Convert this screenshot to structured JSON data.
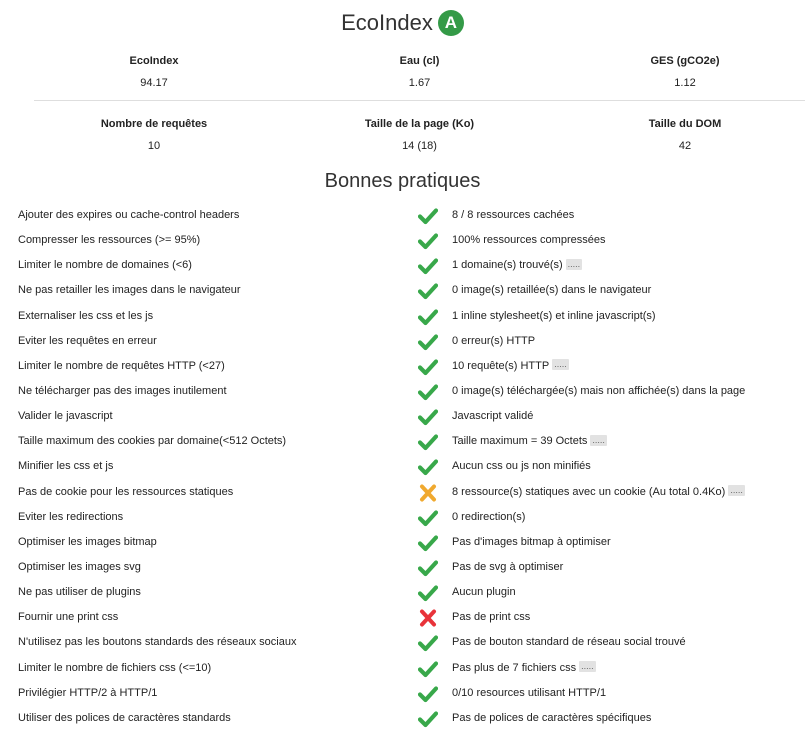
{
  "header": {
    "title": "EcoIndex",
    "grade": "A",
    "grade_color": "#349a47"
  },
  "metrics": {
    "row1": [
      {
        "label": "EcoIndex",
        "value": "94.17"
      },
      {
        "label": "Eau (cl)",
        "value": "1.67"
      },
      {
        "label": "GES (gCO2e)",
        "value": "1.12"
      }
    ],
    "row2": [
      {
        "label": "Nombre de requêtes",
        "value": "10"
      },
      {
        "label": "Taille de la page (Ko)",
        "value": "14 (18)"
      },
      {
        "label": "Taille du DOM",
        "value": "42"
      }
    ]
  },
  "practices_title": "Bonnes pratiques",
  "status_colors": {
    "ok": "#38a84a",
    "warning": "#f0a92f",
    "error": "#e8333a"
  },
  "practices": [
    {
      "name": "Ajouter des expires ou cache-control headers",
      "status": "ok",
      "detail": "8 / 8 ressources cachées",
      "more": ""
    },
    {
      "name": "Compresser les ressources (>= 95%)",
      "status": "ok",
      "detail": "100% ressources compressées",
      "more": ""
    },
    {
      "name": "Limiter le nombre de domaines (<6)",
      "status": "ok",
      "detail": "1 domaine(s) trouvé(s)",
      "more": "....."
    },
    {
      "name": "Ne pas retailler les images dans le navigateur",
      "status": "ok",
      "detail": "0 image(s) retaillée(s) dans le navigateur",
      "more": ""
    },
    {
      "name": "Externaliser les css et les js",
      "status": "ok",
      "detail": "1 inline stylesheet(s) et inline javascript(s)",
      "more": ""
    },
    {
      "name": "Eviter les requêtes en erreur",
      "status": "ok",
      "detail": "0 erreur(s) HTTP",
      "more": ""
    },
    {
      "name": "Limiter le nombre de requêtes HTTP (<27)",
      "status": "ok",
      "detail": "10 requête(s) HTTP",
      "more": "....."
    },
    {
      "name": "Ne télécharger pas des images inutilement",
      "status": "ok",
      "detail": "0 image(s) téléchargée(s) mais non affichée(s) dans la page",
      "more": ""
    },
    {
      "name": "Valider le javascript",
      "status": "ok",
      "detail": "Javascript validé",
      "more": ""
    },
    {
      "name": "Taille maximum des cookies par domaine(<512 Octets)",
      "status": "ok",
      "detail": "Taille maximum = 39 Octets",
      "more": "....."
    },
    {
      "name": "Minifier les css et js",
      "status": "ok",
      "detail": "Aucun css ou js non minifiés",
      "more": ""
    },
    {
      "name": "Pas de cookie pour les ressources statiques",
      "status": "warning",
      "detail": "8 ressource(s) statiques avec un cookie (Au total 0.4Ko)",
      "more": "....."
    },
    {
      "name": "Eviter les redirections",
      "status": "ok",
      "detail": "0 redirection(s)",
      "more": ""
    },
    {
      "name": "Optimiser les images bitmap",
      "status": "ok",
      "detail": "Pas d'images bitmap à optimiser",
      "more": ""
    },
    {
      "name": "Optimiser les images svg",
      "status": "ok",
      "detail": "Pas de svg à optimiser",
      "more": ""
    },
    {
      "name": "Ne pas utiliser de plugins",
      "status": "ok",
      "detail": "Aucun plugin",
      "more": ""
    },
    {
      "name": "Fournir une print css",
      "status": "error",
      "detail": "Pas de print css",
      "more": ""
    },
    {
      "name": "N'utilisez pas les boutons standards des réseaux sociaux",
      "status": "ok",
      "detail": "Pas de bouton standard de réseau social trouvé",
      "more": ""
    },
    {
      "name": "Limiter le nombre de fichiers css (<=10)",
      "status": "ok",
      "detail": "Pas plus de 7 fichiers css",
      "more": "....."
    },
    {
      "name": "Privilégier HTTP/2 à HTTP/1",
      "status": "ok",
      "detail": "0/10 resources utilisant HTTP/1",
      "more": ""
    },
    {
      "name": "Utiliser des polices de caractères standards",
      "status": "ok",
      "detail": "Pas de polices de caractères spécifiques",
      "more": ""
    }
  ]
}
